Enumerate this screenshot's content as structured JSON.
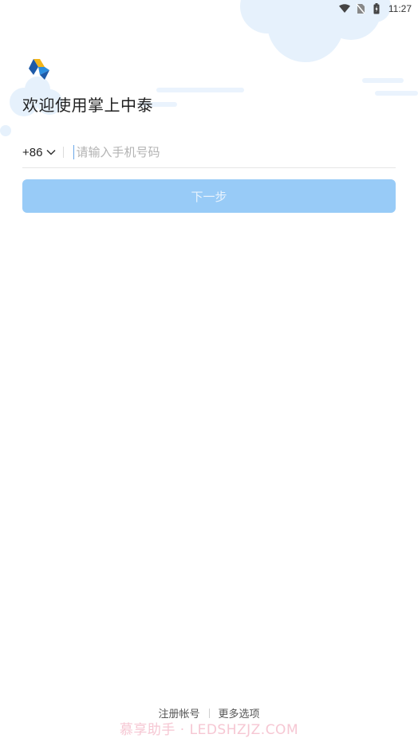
{
  "status_bar": {
    "time": "11:27",
    "icons": [
      "wifi-icon",
      "no-sim-icon",
      "battery-charging-icon"
    ]
  },
  "app": {
    "logo_icon": "zhongtai-logo",
    "welcome_title": "欢迎使用掌上中泰"
  },
  "login": {
    "country_code": "+86",
    "phone_placeholder": "请输入手机号码",
    "phone_value": "",
    "next_button_label": "下一步"
  },
  "footer": {
    "register_label": "注册帐号",
    "more_options_label": "更多选项"
  },
  "watermark": {
    "text": "慕享助手 · LEDSHZJZ.COM"
  },
  "colors": {
    "primary_disabled": "#98cbf7",
    "decor_blue": "#e3f0fc"
  }
}
